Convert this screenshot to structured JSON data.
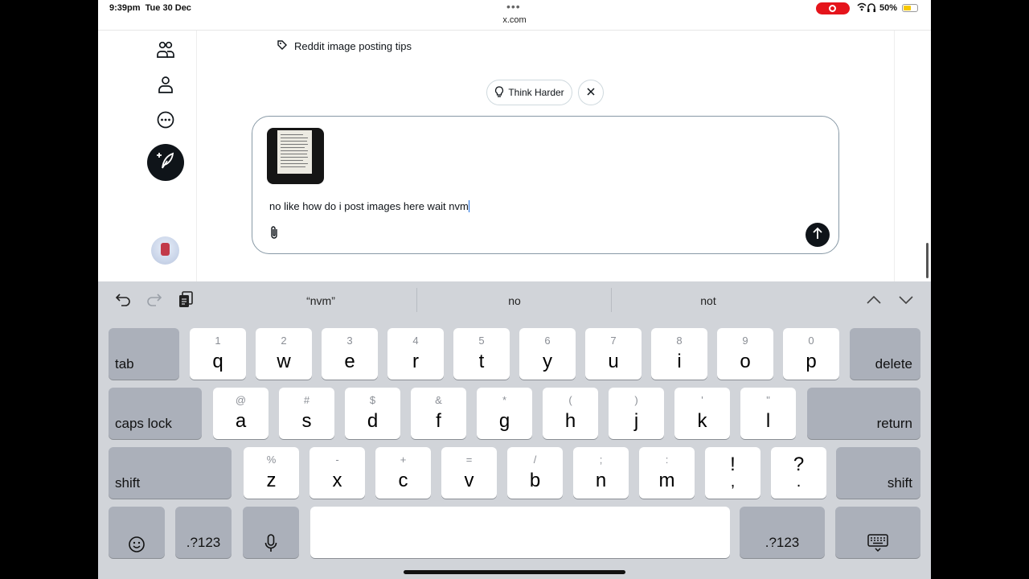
{
  "status": {
    "time": "9:39pm",
    "date": "Tue 30 Dec",
    "url": "x.com",
    "battery": "50%",
    "battery_level": 0.5
  },
  "sidebar": {
    "icons": [
      "communities-icon",
      "profile-icon",
      "more-icon",
      "compose-post-icon"
    ]
  },
  "main": {
    "tip_text": "Reddit image posting tips",
    "think_harder_label": "Think Harder",
    "composer_text": "no like how do i post images here wait nvm"
  },
  "keyboard": {
    "suggestions": [
      "“nvm”",
      "no",
      "not"
    ],
    "row1": [
      {
        "alt": "1",
        "key": "q"
      },
      {
        "alt": "2",
        "key": "w"
      },
      {
        "alt": "3",
        "key": "e"
      },
      {
        "alt": "4",
        "key": "r"
      },
      {
        "alt": "5",
        "key": "t"
      },
      {
        "alt": "6",
        "key": "y"
      },
      {
        "alt": "7",
        "key": "u"
      },
      {
        "alt": "8",
        "key": "i"
      },
      {
        "alt": "9",
        "key": "o"
      },
      {
        "alt": "0",
        "key": "p"
      }
    ],
    "row2": [
      {
        "alt": "@",
        "key": "a"
      },
      {
        "alt": "#",
        "key": "s"
      },
      {
        "alt": "$",
        "key": "d"
      },
      {
        "alt": "&",
        "key": "f"
      },
      {
        "alt": "*",
        "key": "g"
      },
      {
        "alt": "(",
        "key": "h"
      },
      {
        "alt": ")",
        "key": "j"
      },
      {
        "alt": "'",
        "key": "k"
      },
      {
        "alt": "\"",
        "key": "l"
      }
    ],
    "row3": [
      {
        "alt": "%",
        "key": "z"
      },
      {
        "alt": "-",
        "key": "x"
      },
      {
        "alt": "+",
        "key": "c"
      },
      {
        "alt": "=",
        "key": "v"
      },
      {
        "alt": "/",
        "key": "b"
      },
      {
        "alt": ";",
        "key": "n"
      },
      {
        "alt": ":",
        "key": "m"
      }
    ],
    "punct": [
      {
        "top": "!",
        "bottom": ","
      },
      {
        "top": "?",
        "bottom": "."
      }
    ],
    "tab_label": "tab",
    "delete_label": "delete",
    "caps_label": "caps lock",
    "return_label": "return",
    "shift_label": "shift",
    "numbers_label": ".?123"
  }
}
